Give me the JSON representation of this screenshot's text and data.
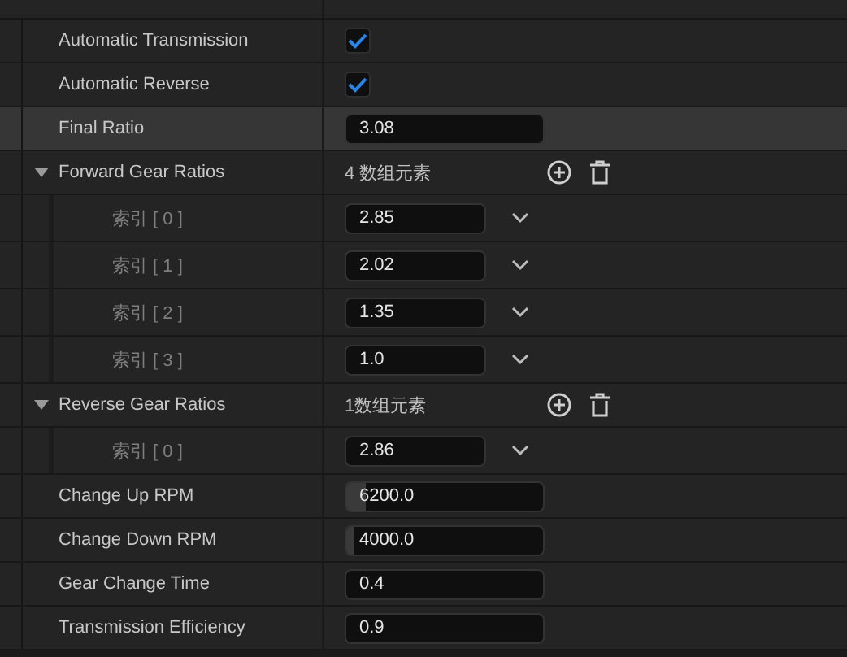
{
  "rows": [
    {
      "kind": "checkbox",
      "label": "Automatic Transmission",
      "checked": true,
      "highlighted": false
    },
    {
      "kind": "checkbox",
      "label": "Automatic Reverse",
      "checked": true,
      "highlighted": false
    },
    {
      "kind": "number",
      "label": "Final Ratio",
      "value": "3.08",
      "highlighted": true
    },
    {
      "kind": "array",
      "label": "Forward Gear Ratios",
      "count": "4 数组元素",
      "expanded": true,
      "highlighted": false,
      "children": [
        {
          "label": "索引 [ 0 ]",
          "value": "2.85"
        },
        {
          "label": "索引 [ 1 ]",
          "value": "2.02"
        },
        {
          "label": "索引 [ 2 ]",
          "value": "1.35"
        },
        {
          "label": "索引 [ 3 ]",
          "value": "1.0"
        }
      ]
    },
    {
      "kind": "array",
      "label": "Reverse Gear Ratios",
      "count": "1数组元素",
      "expanded": true,
      "highlighted": false,
      "children": [
        {
          "label": "索引 [ 0 ]",
          "value": "2.86"
        }
      ]
    },
    {
      "kind": "spin",
      "label": "Change Up RPM",
      "value": "6200.0",
      "level": 0.1,
      "highlighted": false
    },
    {
      "kind": "spin",
      "label": "Change Down RPM",
      "value": "4000.0",
      "level": 0.04,
      "highlighted": false
    },
    {
      "kind": "number",
      "label": "Gear Change Time",
      "value": "0.4",
      "highlighted": false
    },
    {
      "kind": "number",
      "label": "Transmission Efficiency",
      "value": "0.9",
      "highlighted": false
    }
  ]
}
